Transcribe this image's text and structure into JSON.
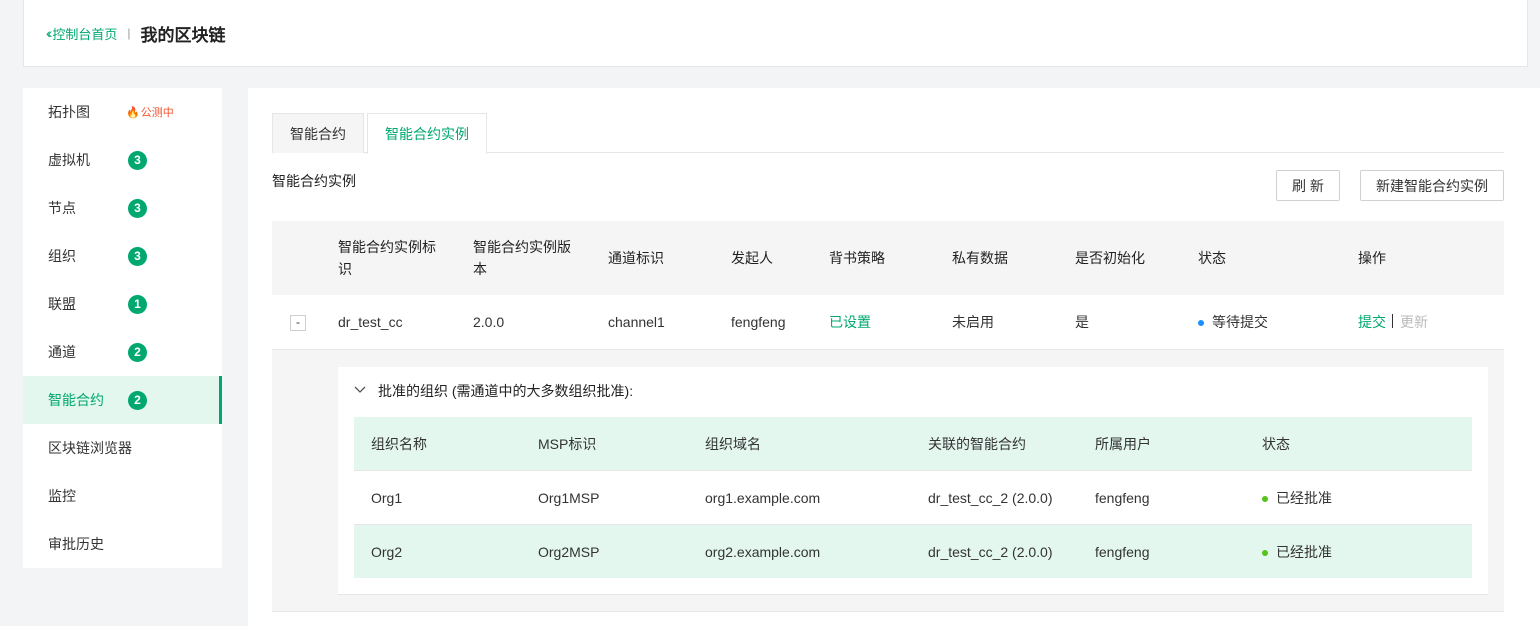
{
  "header": {
    "back_label": "控制台首页",
    "separator": "|",
    "title": "我的区块链"
  },
  "sidebar": {
    "items": [
      {
        "label": "拓扑图",
        "beta": "公测中"
      },
      {
        "label": "虚拟机",
        "count": "3"
      },
      {
        "label": "节点",
        "count": "3"
      },
      {
        "label": "组织",
        "count": "3"
      },
      {
        "label": "联盟",
        "count": "1"
      },
      {
        "label": "通道",
        "count": "2"
      },
      {
        "label": "智能合约",
        "count": "2",
        "active": true
      },
      {
        "label": "区块链浏览器"
      },
      {
        "label": "监控"
      },
      {
        "label": "审批历史"
      }
    ]
  },
  "tabs": [
    {
      "label": "智能合约"
    },
    {
      "label": "智能合约实例",
      "active": true
    }
  ],
  "section_title": "智能合约实例",
  "buttons": {
    "refresh": "刷 新",
    "new_instance": "新建智能合约实例"
  },
  "table": {
    "columns": [
      "智能合约实例标识",
      "智能合约实例版本",
      "通道标识",
      "发起人",
      "背书策略",
      "私有数据",
      "是否初始化",
      "状态",
      "操作"
    ],
    "rows": [
      {
        "expand_symbol": "-",
        "id": "dr_test_cc",
        "version": "2.0.0",
        "channel": "channel1",
        "initiator": "fengfeng",
        "endorsement": "已设置",
        "private_data": "未启用",
        "initialized": "是",
        "status": "等待提交",
        "actions": {
          "submit": "提交",
          "update": "更新"
        }
      }
    ]
  },
  "approval": {
    "title": "批准的组织 (需通道中的大多数组织批准):",
    "columns": [
      "组织名称",
      "MSP标识",
      "组织域名",
      "关联的智能合约",
      "所属用户",
      "状态"
    ],
    "rows": [
      {
        "org": "Org1",
        "msp": "Org1MSP",
        "domain": "org1.example.com",
        "contract": "dr_test_cc_2 (2.0.0)",
        "user": "fengfeng",
        "status": "已经批准"
      },
      {
        "org": "Org2",
        "msp": "Org2MSP",
        "domain": "org2.example.com",
        "contract": "dr_test_cc_2 (2.0.0)",
        "user": "fengfeng",
        "status": "已经批准"
      }
    ]
  },
  "colors": {
    "accent": "#00a870",
    "accent_light": "#e3f7ef",
    "pending_dot": "#1890ff",
    "approved_dot": "#52c41a",
    "beta": "#f5532f"
  }
}
